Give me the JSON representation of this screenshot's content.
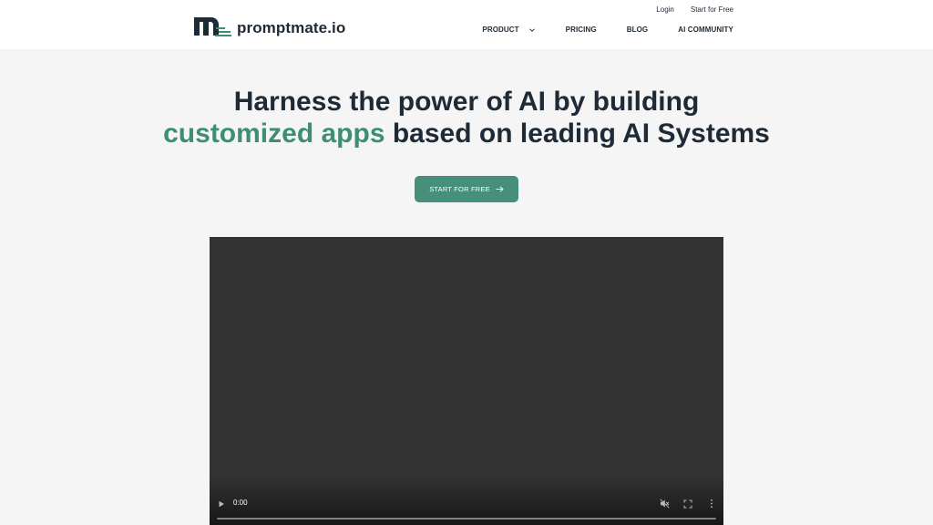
{
  "brand": {
    "name": "promptmate.io"
  },
  "top_links": {
    "login": "Login",
    "start_free": "Start for Free"
  },
  "nav": {
    "product": "PRODUCT",
    "pricing": "PRICING",
    "blog": "BLOG",
    "community": "AI COMMUNITY"
  },
  "hero": {
    "line1": "Harness the power of AI by building",
    "accent": "customized apps",
    "line2_rest": " based on leading AI Systems"
  },
  "cta": {
    "label": "START FOR FREE"
  },
  "video": {
    "time": "0:00",
    "progress": 0
  },
  "icons": {
    "logo": "logo-icon",
    "chevron": "chevron-down-icon",
    "arrow": "arrow-right-icon",
    "play": "play-icon",
    "mute": "mute-icon",
    "fullscreen": "fullscreen-icon",
    "more": "more-vertical-icon"
  },
  "colors": {
    "accent": "#3e8e74",
    "cta_bg": "#468f7b",
    "text_dark": "#1f2a37",
    "page_bg": "#f5f5f5",
    "video_bg": "#333333"
  }
}
